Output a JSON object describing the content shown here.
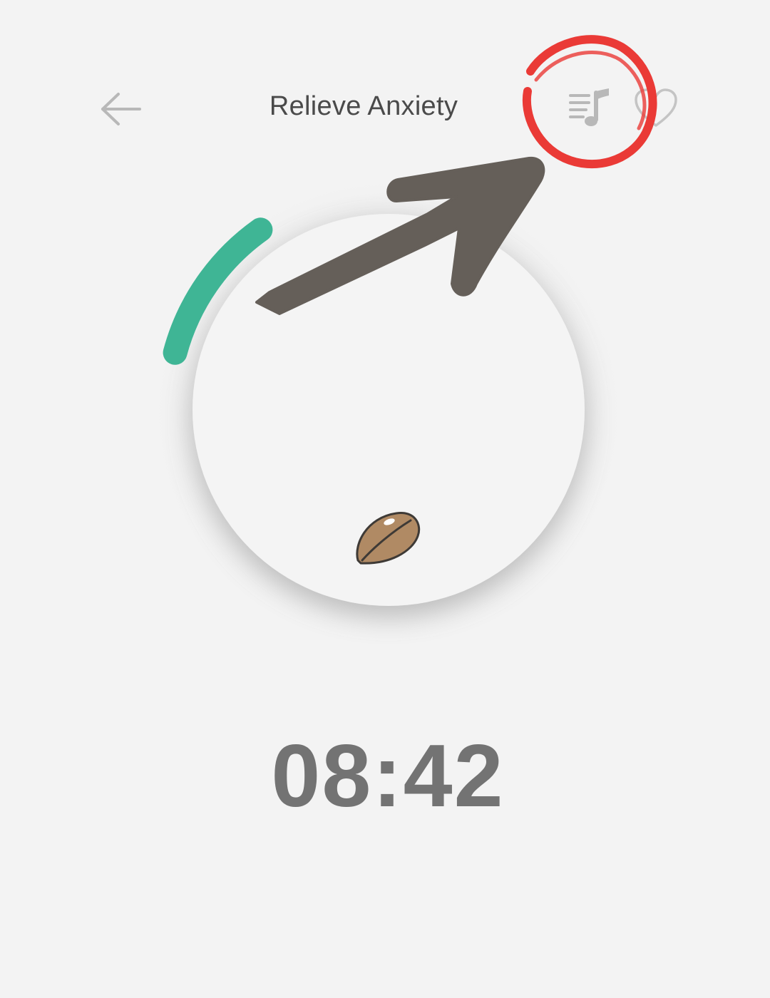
{
  "header": {
    "back_icon": "arrow-left-icon",
    "title": "Relieve Anxiety",
    "music_icon": "music-playlist-icon",
    "favorite_icon": "heart-icon"
  },
  "timer": {
    "display": "08:42",
    "progress_fraction": 0.11,
    "progress_color": "#3fb595",
    "center_icon": "seed-icon"
  },
  "colors": {
    "background": "#f3f3f3",
    "title_text": "#4a4a4a",
    "timer_text": "#737373",
    "icon_gray": "#b8b8b8",
    "annotation_circle": "#ea3a36",
    "annotation_arrow": "#655f59"
  }
}
